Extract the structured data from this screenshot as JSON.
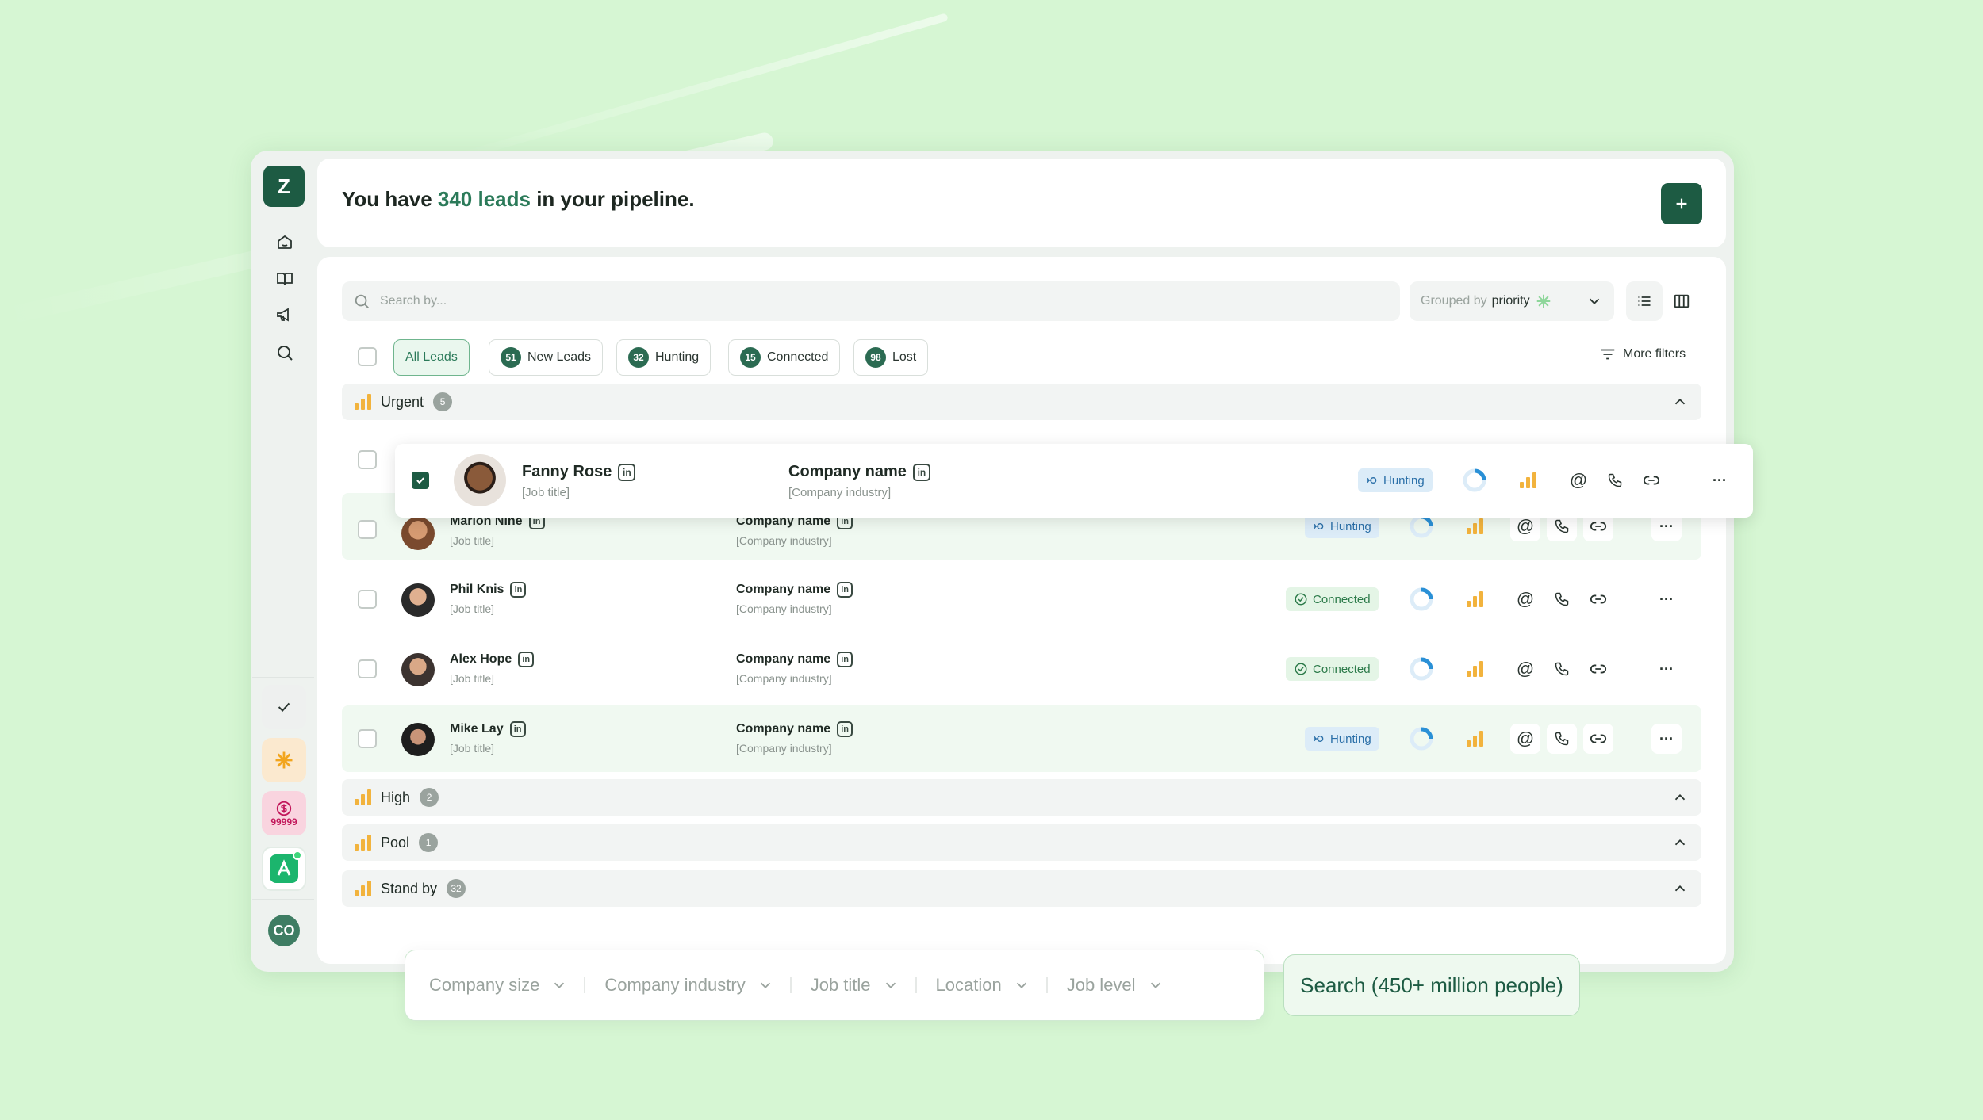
{
  "colors": {
    "accent": "#1d5b43",
    "highlight": "#2b7a59",
    "background": "#d6f6d3",
    "priority": "#f2b33d",
    "hunting": "#2a6fa8",
    "connected": "#2b7a49"
  },
  "sidebar": {
    "logo": "Z",
    "nav_icons": [
      "home-icon",
      "book-icon",
      "megaphone-icon",
      "search-icon"
    ],
    "credits": "99999",
    "user_initials": "CO"
  },
  "header": {
    "prefix": "You have ",
    "count": "340 leads",
    "suffix": " in your pipeline.",
    "add_icon": "plus-icon"
  },
  "toolbar": {
    "search_placeholder": "Search by...",
    "group_prefix": "Grouped by",
    "group_value": "priority",
    "more_filters": "More filters"
  },
  "tabs": [
    {
      "label": "All Leads",
      "count": ""
    },
    {
      "label": "New Leads",
      "count": "51"
    },
    {
      "label": "Hunting",
      "count": "32"
    },
    {
      "label": "Connected",
      "count": "15"
    },
    {
      "label": "Lost",
      "count": "98"
    }
  ],
  "groups": [
    {
      "label": "Urgent",
      "count": "5"
    },
    {
      "label": "High",
      "count": "2"
    },
    {
      "label": "Pool",
      "count": "1"
    },
    {
      "label": "Stand by",
      "count": "32"
    }
  ],
  "float_lead": {
    "name": "Fanny Rose",
    "title": "[Job title]",
    "company": "Company name",
    "industry": "[Company industry]",
    "status": "Hunting"
  },
  "leads": [
    {
      "name": "Marion Nine",
      "title": "[Job title]",
      "company": "Company name",
      "industry": "[Company industry]",
      "status": "Hunting"
    },
    {
      "name": "Phil Knis",
      "title": "[Job title]",
      "company": "Company name",
      "industry": "[Company industry]",
      "status": "Connected"
    },
    {
      "name": "Alex Hope",
      "title": "[Job title]",
      "company": "Company name",
      "industry": "[Company industry]",
      "status": "Connected"
    },
    {
      "name": "Mike Lay",
      "title": "[Job title]",
      "company": "Company name",
      "industry": "[Company industry]",
      "status": "Hunting"
    }
  ],
  "linkedin_badge": "in",
  "more_icon": "···",
  "filters": [
    "Company size",
    "Company industry",
    "Job title",
    "Location",
    "Job level"
  ],
  "search_button": "Search (450+ million people)"
}
